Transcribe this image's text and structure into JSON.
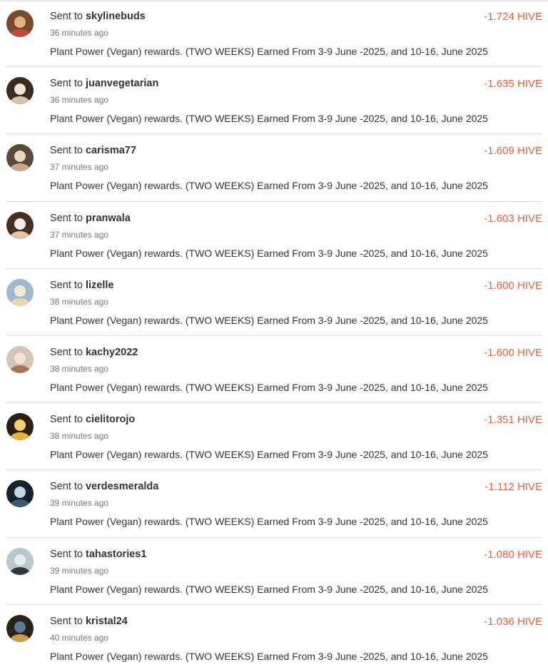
{
  "colors": {
    "amount": "#ef5b36",
    "text": "#333333",
    "muted": "#777777",
    "divider": "#dcdcdc"
  },
  "transfers": [
    {
      "prefix": "Sent to",
      "user": "skylinebuds",
      "time": "36 minutes ago",
      "memo": "Plant Power (Vegan) rewards. (TWO WEEKS) Earned From 3-9 June -2025, and 10-16, June 2025",
      "amount": "-1.724 HIVE",
      "avatar": "avatar-skylinebuds",
      "avatar_colors": [
        "#7a4a2c",
        "#c44a3a",
        "#e2b38a"
      ]
    },
    {
      "prefix": "Sent to",
      "user": "juanvegetarian",
      "time": "36 minutes ago",
      "memo": "Plant Power (Vegan) rewards. (TWO WEEKS) Earned From 3-9 June -2025, and 10-16, June 2025",
      "amount": "-1.635 HIVE",
      "avatar": "avatar-juanvegetarian",
      "avatar_colors": [
        "#3a2a22",
        "#d9c3a7",
        "#f0e6d8"
      ]
    },
    {
      "prefix": "Sent to",
      "user": "carisma77",
      "time": "37 minutes ago",
      "memo": "Plant Power (Vegan) rewards. (TWO WEEKS) Earned From 3-9 June -2025, and 10-16, June 2025",
      "amount": "-1.609 HIVE",
      "avatar": "avatar-carisma77",
      "avatar_colors": [
        "#5a4a3a",
        "#c9a98a",
        "#e8d8c0"
      ]
    },
    {
      "prefix": "Sent to",
      "user": "pranwala",
      "time": "37 minutes ago",
      "memo": "Plant Power (Vegan) rewards. (TWO WEEKS) Earned From 3-9 June -2025, and 10-16, June 2025",
      "amount": "-1.603 HIVE",
      "avatar": "avatar-pranwala",
      "avatar_colors": [
        "#4a2f25",
        "#e8c1a8",
        "#f6ece4"
      ]
    },
    {
      "prefix": "Sent to",
      "user": "lizelle",
      "time": "38 minutes ago",
      "memo": "Plant Power (Vegan) rewards. (TWO WEEKS) Earned From 3-9 June -2025, and 10-16, June 2025",
      "amount": "-1.600 HIVE",
      "avatar": "avatar-lizelle",
      "avatar_colors": [
        "#9fb7cf",
        "#e9d6b0",
        "#f4e9d4"
      ]
    },
    {
      "prefix": "Sent to",
      "user": "kachy2022",
      "time": "38 minutes ago",
      "memo": "Plant Power (Vegan) rewards. (TWO WEEKS) Earned From 3-9 June -2025, and 10-16, June 2025",
      "amount": "-1.600 HIVE",
      "avatar": "avatar-kachy2022",
      "avatar_colors": [
        "#d7c4b4",
        "#a7725a",
        "#f0e2d6"
      ]
    },
    {
      "prefix": "Sent to",
      "user": "cielitorojo",
      "time": "38 minutes ago",
      "memo": "Plant Power (Vegan) rewards. (TWO WEEKS) Earned From 3-9 June -2025, and 10-16, June 2025",
      "amount": "-1.351 HIVE",
      "avatar": "avatar-cielitorojo",
      "avatar_colors": [
        "#2d1f14",
        "#e8b23a",
        "#f7d36a"
      ]
    },
    {
      "prefix": "Sent to",
      "user": "verdesmeralda",
      "time": "39 minutes ago",
      "memo": "Plant Power (Vegan) rewards. (TWO WEEKS) Earned From 3-9 June -2025, and 10-16, June 2025",
      "amount": "-1.112 HIVE",
      "avatar": "avatar-verdesmeralda",
      "avatar_colors": [
        "#14222e",
        "#3d5a6e",
        "#c9d4dc"
      ]
    },
    {
      "prefix": "Sent to",
      "user": "tahastories1",
      "time": "39 minutes ago",
      "memo": "Plant Power (Vegan) rewards. (TWO WEEKS) Earned From 3-9 June -2025, and 10-16, June 2025",
      "amount": "-1.080 HIVE",
      "avatar": "avatar-tahastories1",
      "avatar_colors": [
        "#b9c7cf",
        "#2e3840",
        "#e6ecef"
      ]
    },
    {
      "prefix": "Sent to",
      "user": "kristal24",
      "time": "40 minutes ago",
      "memo": "Plant Power (Vegan) rewards. (TWO WEEKS) Earned From 3-9 June -2025, and 10-16, June 2025",
      "amount": "-1.036 HIVE",
      "avatar": "avatar-kristal24",
      "avatar_colors": [
        "#2a2118",
        "#c79a52",
        "#5e7d95"
      ]
    }
  ]
}
